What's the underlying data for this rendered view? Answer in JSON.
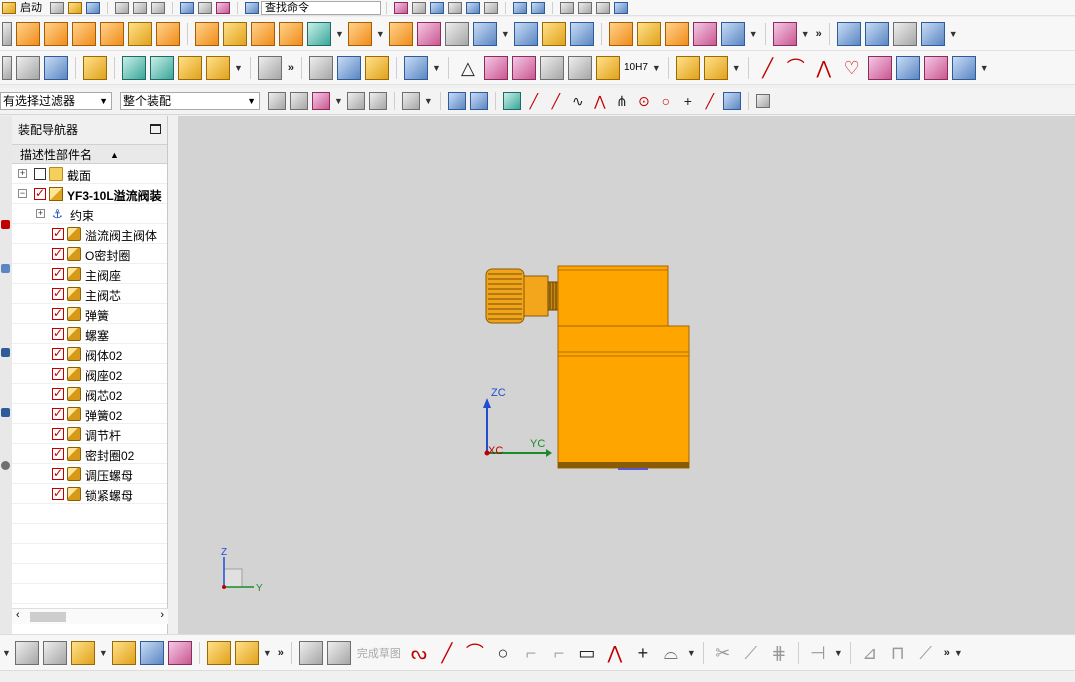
{
  "toolbar_top": {
    "start_label": "启动",
    "search_label": "查找命令"
  },
  "filter_bar": {
    "selection_filter": "有选择过滤器",
    "scope": "整个装配"
  },
  "toolbar_mid": {
    "fit_label": "10H7"
  },
  "navigator": {
    "title": "装配导航器",
    "column_header": "描述性部件名",
    "rows": [
      {
        "label": "截面",
        "type": "folder",
        "level": 0,
        "checked": false,
        "expand": "+"
      },
      {
        "label": "YF3-10L溢流阀装",
        "type": "assembly",
        "level": 0,
        "checked": true,
        "expand": "-"
      },
      {
        "label": "约束",
        "type": "constraint",
        "level": 1,
        "checked": null,
        "expand": "+"
      },
      {
        "label": "溢流阀主阀体",
        "type": "part",
        "level": 1,
        "checked": true
      },
      {
        "label": "O密封圈",
        "type": "part",
        "level": 1,
        "checked": true
      },
      {
        "label": "主阀座",
        "type": "part",
        "level": 1,
        "checked": true
      },
      {
        "label": "主阀芯",
        "type": "part",
        "level": 1,
        "checked": true
      },
      {
        "label": "弹簧",
        "type": "part",
        "level": 1,
        "checked": true
      },
      {
        "label": "螺塞",
        "type": "part",
        "level": 1,
        "checked": true
      },
      {
        "label": "阀体02",
        "type": "part",
        "level": 1,
        "checked": true
      },
      {
        "label": "阀座02",
        "type": "part",
        "level": 1,
        "checked": true
      },
      {
        "label": "阀芯02",
        "type": "part",
        "level": 1,
        "checked": true
      },
      {
        "label": "弹簧02",
        "type": "part",
        "level": 1,
        "checked": true
      },
      {
        "label": "调节杆",
        "type": "part",
        "level": 1,
        "checked": true
      },
      {
        "label": "密封圈02",
        "type": "part",
        "level": 1,
        "checked": true
      },
      {
        "label": "调压螺母",
        "type": "part",
        "level": 1,
        "checked": true
      },
      {
        "label": "锁紧螺母",
        "type": "part",
        "level": 1,
        "checked": true
      }
    ]
  },
  "viewport": {
    "axis_zc": "ZC",
    "axis_yc": "YC",
    "axis_xc": "XC",
    "triad_z": "Z",
    "triad_y": "Y",
    "background": "#d3d3d3",
    "part_color": "#ffa500"
  },
  "bottom_toolbar": {
    "finish_sketch": "完成草图"
  }
}
